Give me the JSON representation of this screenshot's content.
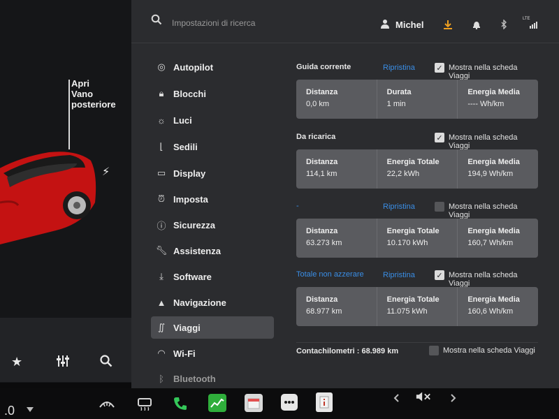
{
  "car": {
    "rear_trunk": "Apri\nVano\nposteriore"
  },
  "search": {
    "placeholder": "Impostazioni di ricerca"
  },
  "user": {
    "name": "Michel"
  },
  "status": {
    "network": "LTE"
  },
  "sidebar": {
    "items": [
      {
        "label": "Autopilot",
        "icon": "steering-wheel-icon"
      },
      {
        "label": "Blocchi",
        "icon": "lock-icon"
      },
      {
        "label": "Luci",
        "icon": "light-icon"
      },
      {
        "label": "Sedili",
        "icon": "seat-icon"
      },
      {
        "label": "Display",
        "icon": "display-icon"
      },
      {
        "label": "Imposta",
        "icon": "alarm-clock-icon"
      },
      {
        "label": "Sicurezza",
        "icon": "info-circle-icon"
      },
      {
        "label": "Assistenza",
        "icon": "wrench-icon"
      },
      {
        "label": "Software",
        "icon": "download-icon"
      },
      {
        "label": "Navigazione",
        "icon": "navigation-arrow-icon"
      },
      {
        "label": "Viaggi",
        "icon": "trip-icon"
      },
      {
        "label": "Wi-Fi",
        "icon": "wifi-icon"
      },
      {
        "label": "Bluetooth",
        "icon": "bluetooth-icon"
      }
    ],
    "active": "Viaggi"
  },
  "trips": [
    {
      "title": "Guida corrente",
      "reset": "Ripristina",
      "show_label": "Mostra nella scheda Viaggi",
      "checked": true,
      "cols": [
        {
          "label": "Distanza",
          "value": "0,0 km"
        },
        {
          "label": "Durata",
          "value": "1 min"
        },
        {
          "label": "Energia Media",
          "value": "---- Wh/km"
        }
      ]
    },
    {
      "title": "Da ricarica",
      "reset": "",
      "show_label": "Mostra nella scheda Viaggi",
      "checked": true,
      "cols": [
        {
          "label": "Distanza",
          "value": "114,1 km"
        },
        {
          "label": "Energia Totale",
          "value": "22,2 kWh"
        },
        {
          "label": "Energia Media",
          "value": "194,9 Wh/km"
        }
      ]
    },
    {
      "title": "-",
      "reset": "Ripristina",
      "show_label": "Mostra nella scheda Viaggi",
      "checked": false,
      "cols": [
        {
          "label": "Distanza",
          "value": "63.273 km"
        },
        {
          "label": "Energia Totale",
          "value": "10.170 kWh"
        },
        {
          "label": "Energia Media",
          "value": "160,7 Wh/km"
        }
      ]
    },
    {
      "title": "Totale non azzerare",
      "reset": "Ripristina",
      "show_label": "Mostra nella scheda Viaggi",
      "checked": true,
      "cols": [
        {
          "label": "Distanza",
          "value": "68.977 km"
        },
        {
          "label": "Energia Totale",
          "value": "11.075 kWh"
        },
        {
          "label": "Energia Media",
          "value": "160,6 Wh/km"
        }
      ]
    }
  ],
  "odometer": {
    "label": "Contachilometri : 68.989 km",
    "show_label": "Mostra nella scheda Viaggi",
    "checked": false
  },
  "bottom": {
    "speed_fragment": ".0"
  },
  "colors": {
    "accent": "#3a8ee6",
    "car_red": "#d01515",
    "phone_green": "#34c759"
  }
}
